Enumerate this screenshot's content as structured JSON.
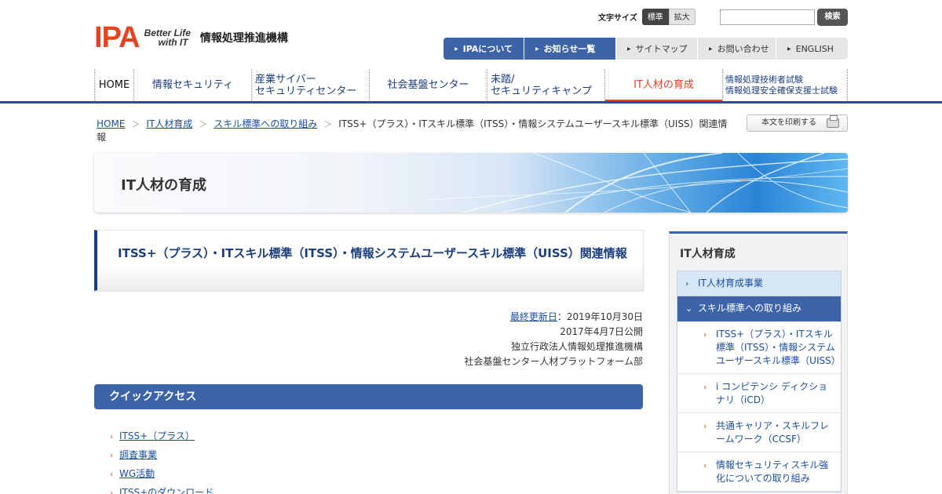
{
  "header": {
    "logo_mark": "IPA",
    "logo_tagline_1": "Better Life",
    "logo_tagline_2": "with IT",
    "org_name": "情報処理推進機構",
    "font_size_label": "文字サイズ",
    "font_size_options": [
      "標準",
      "拡大"
    ],
    "search_placeholder": "",
    "search_button": "検索"
  },
  "util_nav": [
    "IPAについて",
    "お知らせ一覧",
    "サイトマップ",
    "お問い合わせ",
    "ENGLISH"
  ],
  "global_nav": {
    "home": "HOME",
    "security": "情報セキュリティ",
    "icscoe_1": "産業サイバー",
    "icscoe_2": "セキュリティセンター",
    "social": "社会基盤センター",
    "mitou_1": "未踏/",
    "mitou_2": "セキュリティキャンプ",
    "it_jinzai": "IT人材の育成",
    "exam_1": "情報処理技術者試験",
    "exam_2": "情報処理安全確保支援士試験"
  },
  "breadcrumb": {
    "items": [
      "HOME",
      "IT人材育成",
      "スキル標準への取り組み"
    ],
    "current": "ITSS+（プラス）・ITスキル標準（ITSS）・情報システムユーザースキル標準（UISS）関連情報"
  },
  "print_button": "本文を印刷する",
  "banner_title": "IT人材の育成",
  "page_title": "ITSS+（プラス）・ITスキル標準（ITSS）・情報システムユーザースキル標準（UISS）関連情報",
  "meta": {
    "last_updated_label": "最終更新日",
    "last_updated": "：2019年10月30日",
    "published": "2017年4月7日公開",
    "org": "独立行政法人情報処理推進機構",
    "department": "社会基盤センター人材プラットフォーム部"
  },
  "quick_access": {
    "heading": "クイックアクセス",
    "links": [
      "ITSS+（プラス）",
      "調査事業",
      "WG活動",
      "ITSS+のダウンロード"
    ]
  },
  "sidebar": {
    "title": "IT人材育成",
    "menu": [
      {
        "label": "IT人材育成事業",
        "level": 1
      },
      {
        "label": "スキル標準への取り組み",
        "level": 1,
        "active": true
      },
      {
        "label": "ITSS+（プラス）・ITスキル標準（ITSS）・情報システムユーザースキル標準（UISS）",
        "level": 2
      },
      {
        "label": "i コンピテンシ ディクショナリ（iCD）",
        "level": 2
      },
      {
        "label": "共通キャリア・スキルフレームワーク（CCSF）",
        "level": 2
      },
      {
        "label": "情報セキュリティスキル強化についての取り組み",
        "level": 2
      }
    ]
  }
}
